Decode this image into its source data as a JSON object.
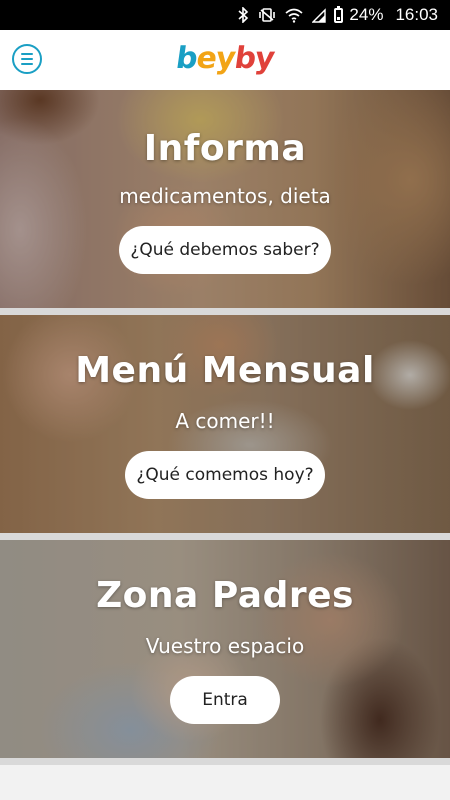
{
  "status_bar": {
    "battery": "24%",
    "time": "16:03",
    "icons": [
      "bluetooth-icon",
      "vibrate-icon",
      "wifi-icon",
      "signal-icon",
      "battery-icon"
    ]
  },
  "header": {
    "menu_icon": "hamburger-menu-icon",
    "logo_letters": [
      "b",
      "e",
      "y",
      "b",
      "y"
    ],
    "logo_colors": [
      "#1a9fc4",
      "#f2a416",
      "#f2a416",
      "#e0413a",
      "#e0413a"
    ]
  },
  "cards": [
    {
      "title": "Informa",
      "subtitle": "medicamentos, dieta",
      "button": "¿Qué debemos saber?"
    },
    {
      "title": "Menú Mensual",
      "subtitle": "A comer!!",
      "button": "¿Qué comemos hoy?"
    },
    {
      "title": "Zona Padres",
      "subtitle": "Vuestro espacio",
      "button": "Entra"
    }
  ]
}
